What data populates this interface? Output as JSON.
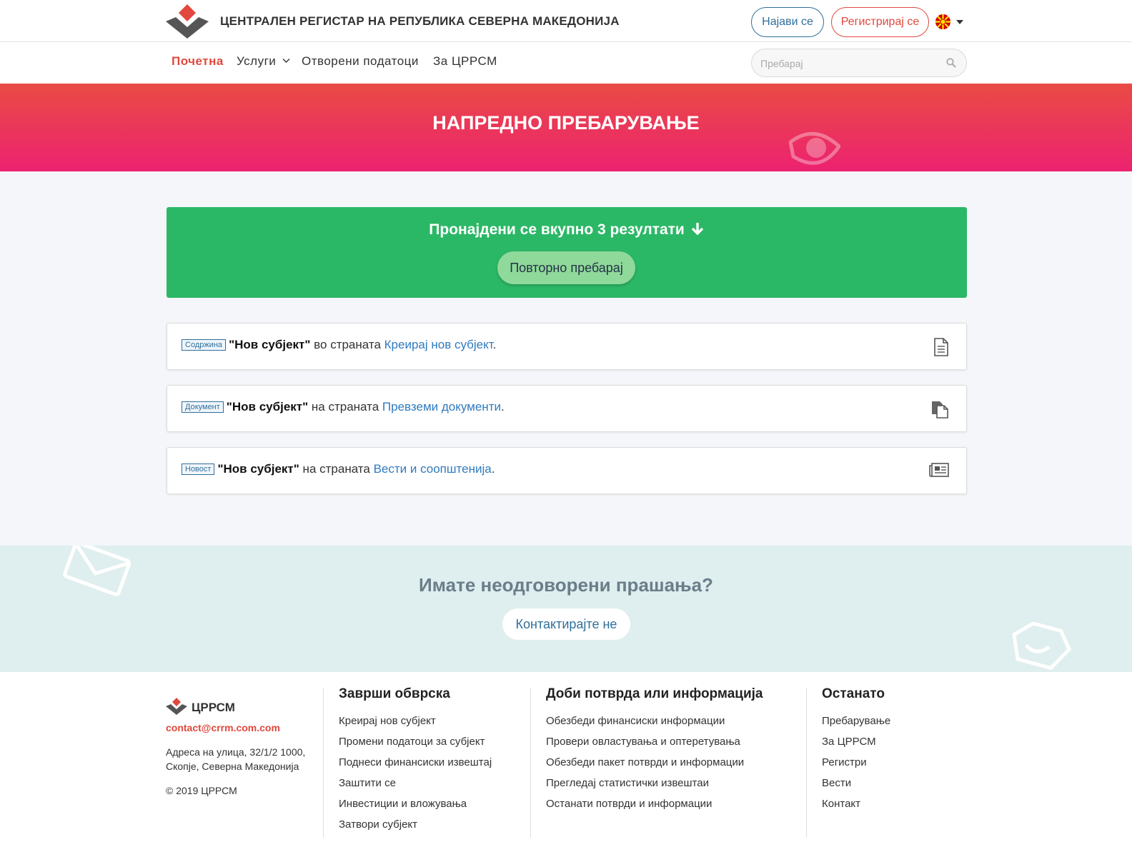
{
  "header": {
    "title": "ЦЕНТРАЛЕН РЕГИСТАР НА РЕПУБЛИКА СЕВЕРНА МАКЕДОНИЈА",
    "login_label": "Најави се",
    "register_label": "Регистрирај се",
    "language_icon": "macedonia-flag-icon"
  },
  "nav": {
    "items": [
      {
        "label": "Почетна",
        "active": true
      },
      {
        "label": "Услуги"
      },
      {
        "label": "Отворени податоци"
      },
      {
        "label": "За ЦРРСМ"
      }
    ],
    "search_placeholder": "Пребарај"
  },
  "hero": {
    "title": "НАПРЕДНО ПРЕБАРУВАЊЕ"
  },
  "results": {
    "summary": "Пронајдени се вкупно 3 резултати",
    "research_label": "Повторно пребарај",
    "items": [
      {
        "tag": "Содржина",
        "term": "\"Нов субјект\"",
        "connector": " во страната ",
        "link": "Креирај нов субјект",
        "end": ".",
        "icon": "document-icon"
      },
      {
        "tag": "Документ",
        "term": "\"Нов субјект\"",
        "connector": " на страната ",
        "link": "Превземи документи",
        "end": ".",
        "icon": "documents-icon"
      },
      {
        "tag": "Новост",
        "term": "\"Нов субјект\"",
        "connector": " на страната ",
        "link": "Вести и соопштенија",
        "end": ".",
        "icon": "newspaper-icon"
      }
    ]
  },
  "questions": {
    "title": "Имате неодговорени прашања?",
    "contact_label": "Контактирајте не"
  },
  "footer": {
    "brand": "ЦРРСМ",
    "email": "contact@crrm.com.com",
    "address": "Адреса на улица, 32/1/2 1000, Скопје, Северна Македонија",
    "copyright": "© 2019  ЦРРСМ",
    "columns": [
      {
        "title": "Заврши обврска",
        "links": [
          "Креирај нов субјект",
          "Промени податоци за субјект",
          "Поднеси финансиски извештај",
          "Заштити се",
          "Инвестиции и вложувања",
          "Затвори субјект"
        ]
      },
      {
        "title": "Доби потврда или информација",
        "links": [
          "Обезбеди финансиски информации",
          "Провери овластувања и оптеретувања",
          "Обезбеди пакет потврди и информации",
          "Прегледај статистички извештаи",
          "Останати потврди и информации"
        ]
      },
      {
        "title": "Останато",
        "links": [
          "Пребарување",
          "За ЦРРСМ",
          "Регистри",
          "Вести",
          "Контакт"
        ]
      }
    ]
  },
  "colors": {
    "brand_red": "#e2483d",
    "brand_blue": "#2f6f9b",
    "success_green": "#2bb866",
    "hero_gradient_top": "#e94b44",
    "hero_gradient_bottom": "#ec2270"
  }
}
